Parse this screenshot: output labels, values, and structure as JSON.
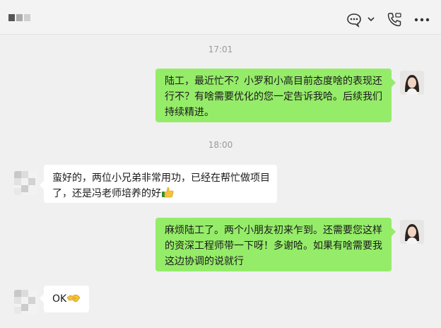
{
  "header": {
    "more_icon": "ellipsis-icon",
    "chat_icon": "chat-bubble-icon",
    "call_icon": "phone-icon",
    "colors": {
      "header_bg": "#f3f3f3",
      "window_bg": "#f0f0f0"
    }
  },
  "timestamps": [
    "17:01",
    "18:00"
  ],
  "messages": [
    {
      "sender": "me",
      "text": "陆工，最近忙不？小罗和小高目前态度啥的表现还\n行不？有啥需要优化的您一定告诉我哈。后续我们\n持续精进。"
    },
    {
      "sender": "other",
      "text": "蛮好的，两位小兄弟非常用功，已经在帮忙做项目\n了，还是冯老师培养的好",
      "emoji": "thumbs-up-icon"
    },
    {
      "sender": "me",
      "text": "麻烦陆工了。两个小朋友初来乍到。还需要您这样\n的资深工程师带一下呀！多谢哈。如果有啥需要我\n这边协调的说就行"
    },
    {
      "sender": "other",
      "text": "OK",
      "emoji": "handshake-icon"
    }
  ],
  "bubble_colors": {
    "me": "#95ec69",
    "other": "#ffffff"
  }
}
